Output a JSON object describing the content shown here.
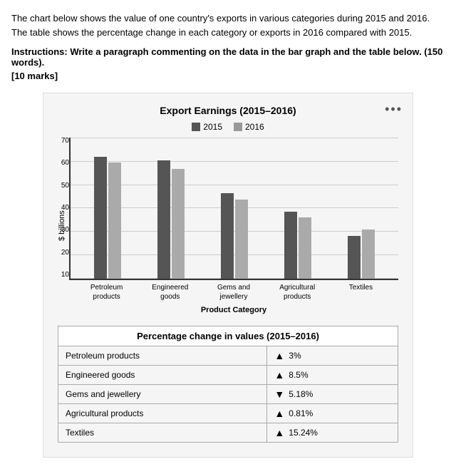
{
  "intro": {
    "paragraph": "The chart below shows the value of one country's exports in various categories during 2015 and 2016. The table shows the percentage change in each category or exports in 2016 compared with 2015.",
    "instructions": "Instructions: Write a paragraph commenting on the data in the bar graph and the table below. (150 words).",
    "marks": "[10 marks]"
  },
  "chart": {
    "title": "Export Earnings (2015–2016)",
    "three_dots": "•••",
    "legend": [
      {
        "label": "2015",
        "color": "#555"
      },
      {
        "label": "2016",
        "color": "#999"
      }
    ],
    "y_axis_label": "$ billions",
    "y_ticks": [
      "70",
      "60",
      "50",
      "40",
      "30",
      "20",
      "10"
    ],
    "max_value": 70,
    "bars": [
      {
        "category": "Petroleum\nproducts",
        "val2015": 60,
        "val2016": 57
      },
      {
        "category": "Engineered\ngoods",
        "val2015": 58,
        "val2016": 54
      },
      {
        "category": "Gems and\njewellery",
        "val2015": 42,
        "val2016": 39
      },
      {
        "category": "Agricultural\nproducts",
        "val2015": 33,
        "val2016": 30
      },
      {
        "category": "Textiles",
        "val2015": 21,
        "val2016": 24
      }
    ],
    "x_axis_label": "Product Category"
  },
  "table": {
    "header": "Percentage change in values (2015–2016)",
    "rows": [
      {
        "category": "Petroleum products",
        "direction": "up",
        "value": "3%"
      },
      {
        "category": "Engineered goods",
        "direction": "up",
        "value": "8.5%"
      },
      {
        "category": "Gems and jewellery",
        "direction": "down",
        "value": "5.18%"
      },
      {
        "category": "Agricultural products",
        "direction": "up",
        "value": "0.81%"
      },
      {
        "category": "Textiles",
        "direction": "up",
        "value": "15.24%"
      }
    ]
  },
  "colors": {
    "bar2015": "#555",
    "bar2016": "#aaa"
  }
}
